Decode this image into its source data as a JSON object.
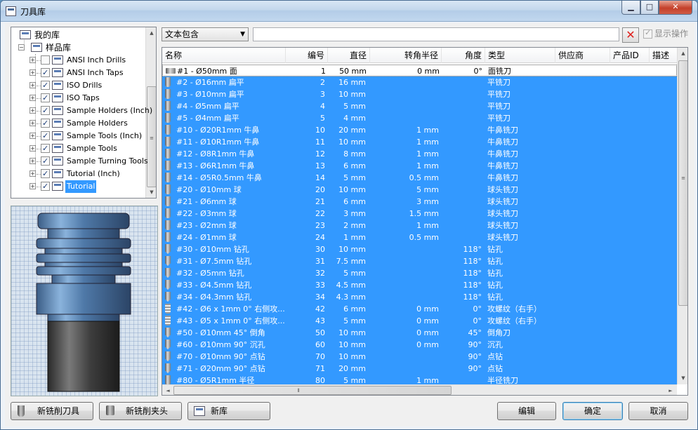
{
  "window": {
    "title": "刀具库",
    "min": "▁",
    "max": "□",
    "close": "✕"
  },
  "tree": {
    "nodes": [
      {
        "label": "我的库"
      },
      {
        "label": "样品库"
      },
      {
        "label": "ANSI Inch Drills",
        "checked": false
      },
      {
        "label": "ANSI Inch Taps",
        "checked": true
      },
      {
        "label": "ISO Drills",
        "checked": true
      },
      {
        "label": "ISO Taps",
        "checked": true
      },
      {
        "label": "Sample Holders (Inch)",
        "checked": true
      },
      {
        "label": "Sample Holders",
        "checked": true
      },
      {
        "label": "Sample Tools (Inch)",
        "checked": true
      },
      {
        "label": "Sample Tools",
        "checked": true
      },
      {
        "label": "Sample Turning Tools",
        "checked": true
      },
      {
        "label": "Tutorial (Inch)",
        "checked": true
      },
      {
        "label": "Tutorial",
        "checked": true,
        "selected": true
      }
    ]
  },
  "filter": {
    "mode": "文本包含",
    "search_value": "",
    "show_ops": "显示操作"
  },
  "grid": {
    "columns": [
      "名称",
      "编号",
      "直径",
      "转角半径",
      "角度",
      "类型",
      "供应商",
      "产品ID",
      "描述"
    ],
    "rows": [
      {
        "icon": "face",
        "name": "#1 - Ø50mm 面",
        "num": "1",
        "dia": "50 mm",
        "cr": "0 mm",
        "angle": "0°",
        "type": "面铣刀"
      },
      {
        "icon": "mill",
        "name": "#2 - Ø16mm 扁平",
        "num": "2",
        "dia": "16 mm",
        "cr": "",
        "angle": "",
        "type": "平铣刀"
      },
      {
        "icon": "mill",
        "name": "#3 - Ø10mm 扁平",
        "num": "3",
        "dia": "10 mm",
        "cr": "",
        "angle": "",
        "type": "平铣刀"
      },
      {
        "icon": "mill",
        "name": "#4 - Ø5mm 扁平",
        "num": "4",
        "dia": "5 mm",
        "cr": "",
        "angle": "",
        "type": "平铣刀"
      },
      {
        "icon": "mill",
        "name": "#5 - Ø4mm 扁平",
        "num": "5",
        "dia": "4 mm",
        "cr": "",
        "angle": "",
        "type": "平铣刀"
      },
      {
        "icon": "mill",
        "name": "#10 - Ø20R1mm 牛鼻",
        "num": "10",
        "dia": "20 mm",
        "cr": "1 mm",
        "angle": "",
        "type": "牛鼻铣刀"
      },
      {
        "icon": "mill",
        "name": "#11 - Ø10R1mm 牛鼻",
        "num": "11",
        "dia": "10 mm",
        "cr": "1 mm",
        "angle": "",
        "type": "牛鼻铣刀"
      },
      {
        "icon": "mill",
        "name": "#12 - Ø8R1mm 牛鼻",
        "num": "12",
        "dia": "8 mm",
        "cr": "1 mm",
        "angle": "",
        "type": "牛鼻铣刀"
      },
      {
        "icon": "mill",
        "name": "#13 - Ø6R1mm 牛鼻",
        "num": "13",
        "dia": "6 mm",
        "cr": "1 mm",
        "angle": "",
        "type": "牛鼻铣刀"
      },
      {
        "icon": "mill",
        "name": "#14 - Ø5R0.5mm 牛鼻",
        "num": "14",
        "dia": "5 mm",
        "cr": "0.5 mm",
        "angle": "",
        "type": "牛鼻铣刀"
      },
      {
        "icon": "mill",
        "name": "#20 - Ø10mm 球",
        "num": "20",
        "dia": "10 mm",
        "cr": "5 mm",
        "angle": "",
        "type": "球头铣刀"
      },
      {
        "icon": "mill",
        "name": "#21 - Ø6mm 球",
        "num": "21",
        "dia": "6 mm",
        "cr": "3 mm",
        "angle": "",
        "type": "球头铣刀"
      },
      {
        "icon": "mill",
        "name": "#22 - Ø3mm 球",
        "num": "22",
        "dia": "3 mm",
        "cr": "1.5 mm",
        "angle": "",
        "type": "球头铣刀"
      },
      {
        "icon": "mill",
        "name": "#23 - Ø2mm 球",
        "num": "23",
        "dia": "2 mm",
        "cr": "1 mm",
        "angle": "",
        "type": "球头铣刀"
      },
      {
        "icon": "mill",
        "name": "#24 - Ø1mm 球",
        "num": "24",
        "dia": "1 mm",
        "cr": "0.5 mm",
        "angle": "",
        "type": "球头铣刀"
      },
      {
        "icon": "drill",
        "name": "#30 - Ø10mm 钻孔",
        "num": "30",
        "dia": "10 mm",
        "cr": "",
        "angle": "118°",
        "type": "钻孔"
      },
      {
        "icon": "drill",
        "name": "#31 - Ø7.5mm 钻孔",
        "num": "31",
        "dia": "7.5 mm",
        "cr": "",
        "angle": "118°",
        "type": "钻孔"
      },
      {
        "icon": "drill",
        "name": "#32 - Ø5mm 钻孔",
        "num": "32",
        "dia": "5 mm",
        "cr": "",
        "angle": "118°",
        "type": "钻孔"
      },
      {
        "icon": "drill",
        "name": "#33 - Ø4.5mm 钻孔",
        "num": "33",
        "dia": "4.5 mm",
        "cr": "",
        "angle": "118°",
        "type": "钻孔"
      },
      {
        "icon": "drill",
        "name": "#34 - Ø4.3mm 钻孔",
        "num": "34",
        "dia": "4.3 mm",
        "cr": "",
        "angle": "118°",
        "type": "钻孔"
      },
      {
        "icon": "tap",
        "name": "#42 - Ø6 x 1mm 0° 右侧攻...",
        "num": "42",
        "dia": "6 mm",
        "cr": "0 mm",
        "angle": "0°",
        "type": "攻螺纹（右手）"
      },
      {
        "icon": "tap",
        "name": "#43 - Ø5 x 1mm 0° 右侧攻...",
        "num": "43",
        "dia": "5 mm",
        "cr": "0 mm",
        "angle": "0°",
        "type": "攻螺纹（右手）"
      },
      {
        "icon": "drill",
        "name": "#50 - Ø10mm 45° 倒角",
        "num": "50",
        "dia": "10 mm",
        "cr": "0 mm",
        "angle": "45°",
        "type": "倒角刀"
      },
      {
        "icon": "drill",
        "name": "#60 - Ø10mm 90° 沉孔",
        "num": "60",
        "dia": "10 mm",
        "cr": "0 mm",
        "angle": "90°",
        "type": "沉孔"
      },
      {
        "icon": "drill",
        "name": "#70 - Ø10mm 90° 点钻",
        "num": "70",
        "dia": "10 mm",
        "cr": "",
        "angle": "90°",
        "type": "点钻"
      },
      {
        "icon": "drill",
        "name": "#71 - Ø20mm 90° 点钻",
        "num": "71",
        "dia": "20 mm",
        "cr": "",
        "angle": "90°",
        "type": "点钻"
      },
      {
        "icon": "mill",
        "name": "#80 - Ø5R1mm 半径",
        "num": "80",
        "dia": "5 mm",
        "cr": "1 mm",
        "angle": "",
        "type": "半径铣刀"
      }
    ]
  },
  "buttons": {
    "new_tool": "新铣削刀具",
    "new_holder": "新铣削夹头",
    "new_lib": "新库",
    "edit": "编辑",
    "ok": "确定",
    "cancel": "取消"
  },
  "scroll": {
    "up": "▲",
    "down": "▼",
    "left": "◄",
    "right": "►",
    "grip_v": "≡",
    "grip_h": "⦀"
  }
}
